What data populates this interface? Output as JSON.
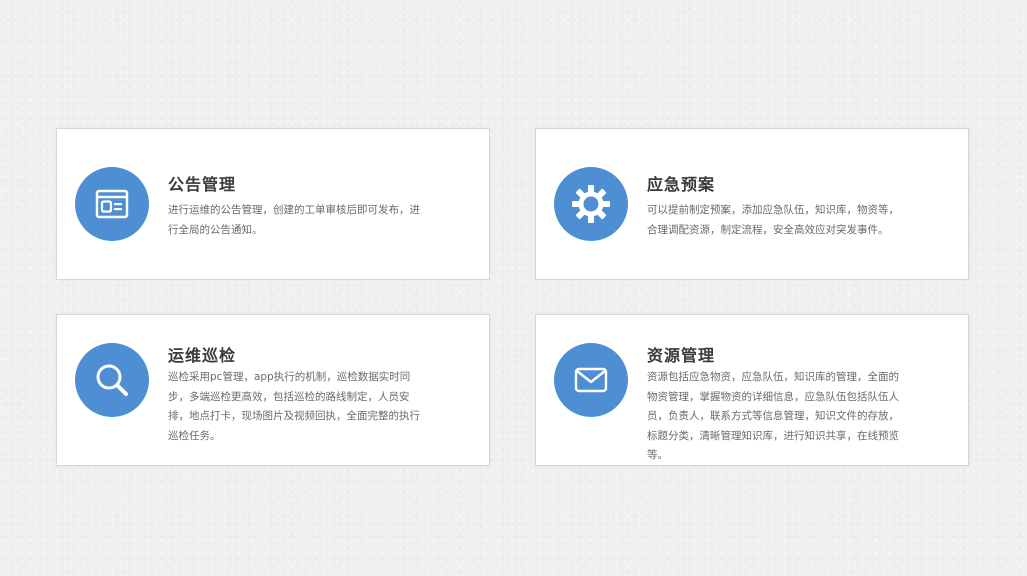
{
  "colors": {
    "accent": "#4e8fd4",
    "card_bg": "#ffffff",
    "title": "#3a3a3a",
    "text": "#6a6a6a"
  },
  "cards": [
    {
      "icon": "announcement-icon",
      "title": "公告管理",
      "desc": "进行运维的公告管理，创建的工单审核后即可发布，进行全局的公告通知。"
    },
    {
      "icon": "gear-icon",
      "title": "应急预案",
      "desc": "可以提前制定预案，添加应急队伍，知识库，物资等，合理调配资源，制定流程，安全高效应对突发事件。"
    },
    {
      "icon": "search-icon",
      "title": "运维巡检",
      "desc": "巡检采用pc管理，app执行的机制，巡检数据实时同步，多端巡检更高效，包括巡检的路线制定，人员安排，地点打卡，现场图片及视频回执，全面完整的执行巡检任务。"
    },
    {
      "icon": "mail-icon",
      "title": "资源管理",
      "desc": "资源包括应急物资，应急队伍，知识库的管理，全面的物资管理，掌握物资的详细信息，应急队伍包括队伍人员，负责人，联系方式等信息管理，知识文件的存放，标题分类，清晰管理知识库，进行知识共享，在线预览等。"
    }
  ]
}
